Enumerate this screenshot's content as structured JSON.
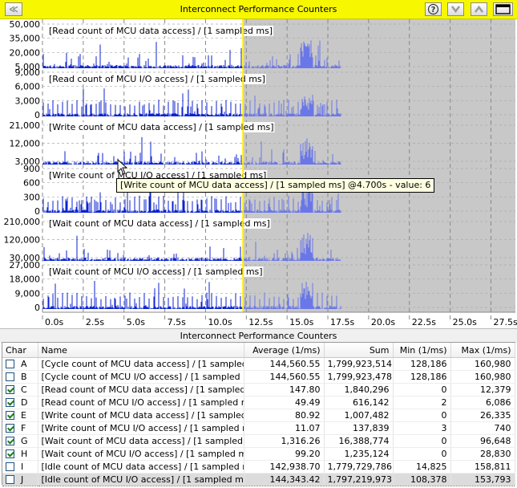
{
  "window": {
    "title": "Interconnect Performance Counters",
    "buttons": {
      "back": "≪",
      "help": "?",
      "down": "∨",
      "up": "∧",
      "maximize": "▬"
    }
  },
  "colors": {
    "titlebar": "#f7f700",
    "series": "#0b22d0",
    "series_dim": "#6a77e8",
    "shade": "#c8c8c8",
    "cursor_line": "#ffee00"
  },
  "chart_data": [
    {
      "type": "area",
      "title": "[Read count of MCU data access] / [1 sampled ms]",
      "y_ticks": [
        "50,000",
        "35,000",
        "20,000",
        "5,000"
      ],
      "ylim": [
        0,
        50000
      ]
    },
    {
      "type": "area",
      "title": "[Read count of MCU I/O access] / [1 sampled ms]",
      "y_ticks": [
        "9,000",
        "6,000",
        "3,000",
        "0"
      ],
      "ylim": [
        0,
        9000
      ]
    },
    {
      "type": "area",
      "title": "[Write count of MCU data access] / [1 sampled ms]",
      "y_ticks": [
        "21,000",
        "12,000",
        "3,000"
      ],
      "ylim": [
        0,
        27000
      ]
    },
    {
      "type": "area",
      "title": "[Write count of MCU I/O access] / [1 sampled ms]",
      "y_ticks": [
        "900",
        "600",
        "300",
        "0"
      ],
      "ylim": [
        0,
        900
      ]
    },
    {
      "type": "area",
      "title": "[Wait count of MCU data access] / [1 sampled ms]",
      "y_ticks": [
        "210,000",
        "120,000",
        "30,000"
      ],
      "ylim": [
        0,
        270000
      ]
    },
    {
      "type": "area",
      "title": "[Wait count of MCU I/O access] / [1 sampled ms]",
      "y_ticks": [
        "27,000",
        "18,000",
        "9,000",
        "0"
      ],
      "ylim": [
        0,
        27000
      ]
    }
  ],
  "x_axis": {
    "ticks": [
      "0.0s",
      "2.5s",
      "5.0s",
      "7.5s",
      "10.0s",
      "12.5s",
      "15.0s",
      "17.5s",
      "20.0s",
      "22.5s",
      "25.0s",
      "27.5s"
    ],
    "xlim": [
      0,
      29
    ],
    "cursor_time": 12.3,
    "data_end": 18.3
  },
  "tooltip": "[Write count of MCU data access] / [1 sampled ms] @4.700s - value: 6",
  "table": {
    "title": "Interconnect Performance Counters",
    "columns": {
      "char": "Char",
      "name": "Name",
      "average": "Average (1/ms)",
      "sum": "Sum",
      "min": "Min (1/ms)",
      "max": "Max (1/ms)"
    },
    "rows": [
      {
        "checked": false,
        "char": "A",
        "name": "[Cycle count of MCU data access] / [1 sampled ms]",
        "average": "144,560.55",
        "sum": "1,799,923,514",
        "min": "128,186",
        "max": "160,980"
      },
      {
        "checked": false,
        "char": "B",
        "name": "[Cycle count of MCU I/O access] / [1 sampled ms]",
        "average": "144,560.55",
        "sum": "1,799,923,478",
        "min": "128,186",
        "max": "160,980"
      },
      {
        "checked": true,
        "char": "C",
        "name": "[Read count of MCU data access] / [1 sampled ms]",
        "average": "147.80",
        "sum": "1,840,296",
        "min": "0",
        "max": "12,379"
      },
      {
        "checked": true,
        "char": "D",
        "name": "[Read count of MCU I/O access] / [1 sampled ms]",
        "average": "49.49",
        "sum": "616,142",
        "min": "2",
        "max": "6,086"
      },
      {
        "checked": true,
        "char": "E",
        "name": "[Write count of MCU data access] / [1 sampled ms]",
        "average": "80.92",
        "sum": "1,007,482",
        "min": "0",
        "max": "26,335"
      },
      {
        "checked": true,
        "char": "F",
        "name": "[Write count of MCU I/O access] / [1 sampled ms]",
        "average": "11.07",
        "sum": "137,839",
        "min": "3",
        "max": "740"
      },
      {
        "checked": true,
        "char": "G",
        "name": "[Wait count of MCU data access] / [1 sampled ms]",
        "average": "1,316.26",
        "sum": "16,388,774",
        "min": "0",
        "max": "96,648"
      },
      {
        "checked": true,
        "char": "H",
        "name": "[Wait count of MCU I/O access] / [1 sampled ms]",
        "average": "99.20",
        "sum": "1,235,124",
        "min": "0",
        "max": "28,830"
      },
      {
        "checked": false,
        "char": "I",
        "name": "[Idle count of MCU data access] / [1 sampled ms]",
        "average": "142,938.70",
        "sum": "1,779,729,786",
        "min": "14,825",
        "max": "158,811"
      },
      {
        "checked": false,
        "char": "J",
        "name": "[Idle count of MCU I/O access] / [1 sampled ms]",
        "average": "144,343.42",
        "sum": "1,797,219,973",
        "min": "108,378",
        "max": "153,793",
        "selected": true
      }
    ]
  }
}
